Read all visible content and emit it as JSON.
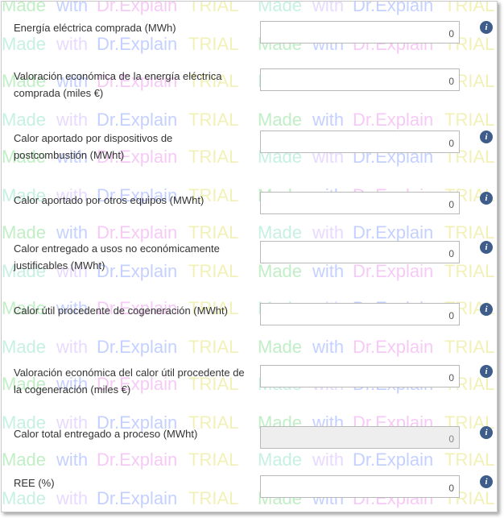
{
  "watermark": {
    "made": "Made",
    "with": "with",
    "brand": "Dr.Explain",
    "trial": "TRIAL"
  },
  "rows": [
    {
      "label": "Energía eléctrica comprada (MWh)",
      "value": "0",
      "info": "i",
      "disabled": false
    },
    {
      "label": "Valoración económica de la energía eléctrica comprada (miles €)",
      "value": "0",
      "info": "",
      "disabled": false
    },
    {
      "label": "Calor aportado por dispositivos de postcombustión (MWht)",
      "value": "0",
      "info": "i",
      "disabled": false
    },
    {
      "label": "Calor aportado por otros equipos (MWht)",
      "value": "0",
      "info": "i",
      "disabled": false
    },
    {
      "label": "Calor entregado a usos no económicamente justificables (MWht)",
      "value": "0",
      "info": "i",
      "disabled": false
    },
    {
      "label": "Calor útil procedente de cogeneración (MWht)",
      "value": "0",
      "info": "i",
      "disabled": false
    },
    {
      "label": "Valoración económica del calor útil procedente de la cogeneración (miles €)",
      "value": "0",
      "info": "i",
      "disabled": false
    },
    {
      "label": "Calor total entregado a proceso (MWht)",
      "value": "0",
      "info": "i",
      "disabled": true
    },
    {
      "label": "REE (%)",
      "value": "0",
      "info": "i",
      "disabled": false
    }
  ]
}
